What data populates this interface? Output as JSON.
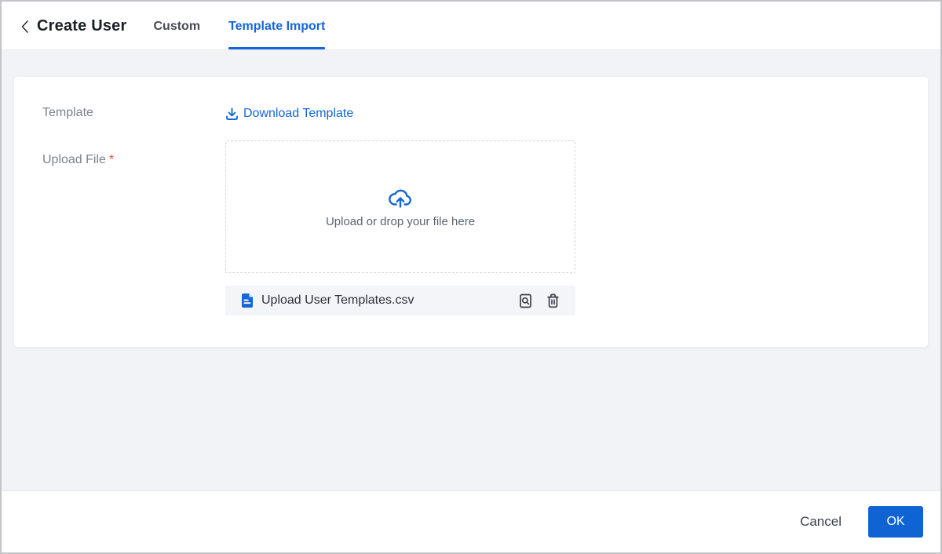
{
  "header": {
    "title": "Create User",
    "back_icon": "chevron-left",
    "tabs": [
      {
        "label": "Custom",
        "active": false
      },
      {
        "label": "Template Import",
        "active": true
      }
    ]
  },
  "form": {
    "template_label": "Template",
    "download_link_label": "Download Template",
    "download_icon": "download-arrow-tray",
    "upload_label": "Upload File",
    "required_marker": "*",
    "dropzone_hint": "Upload or drop your file here",
    "dropzone_icon": "cloud-upload",
    "uploaded_file": {
      "name": "Upload User Templates.csv",
      "file_icon": "document-blue",
      "actions": [
        {
          "name": "preview",
          "icon": "file-search"
        },
        {
          "name": "delete",
          "icon": "trash"
        }
      ]
    }
  },
  "footer": {
    "cancel_label": "Cancel",
    "ok_label": "OK"
  },
  "colors": {
    "accent": "#1567d8",
    "ok_button": "#0f63d3",
    "required": "#f0483e",
    "body_background": "#f2f3f7",
    "file_row_background": "#f4f5f8"
  }
}
